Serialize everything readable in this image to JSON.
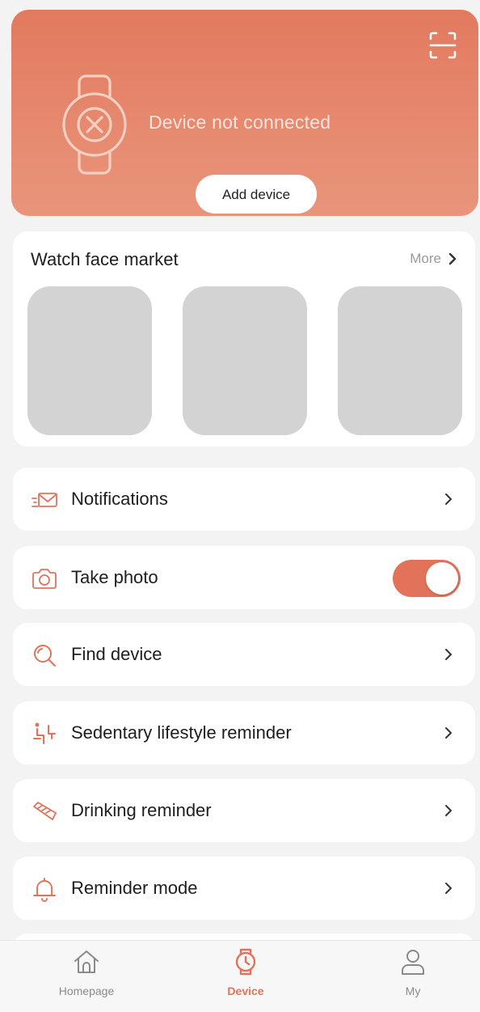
{
  "header": {
    "status": "Device not connected",
    "add_button": "Add device"
  },
  "market": {
    "title": "Watch face market",
    "more": "More"
  },
  "settings": [
    {
      "label": "Notifications",
      "icon": "envelope-icon",
      "control": "chevron"
    },
    {
      "label": "Take photo",
      "icon": "camera-icon",
      "control": "toggle",
      "toggle_on": true
    },
    {
      "label": "Find device",
      "icon": "magnifier-icon",
      "control": "chevron"
    },
    {
      "label": "Sedentary lifestyle reminder",
      "icon": "sedentary-icon",
      "control": "chevron"
    },
    {
      "label": "Drinking reminder",
      "icon": "cup-icon",
      "control": "chevron"
    },
    {
      "label": "Reminder mode",
      "icon": "bell-icon",
      "control": "chevron"
    }
  ],
  "tabs": [
    {
      "label": "Homepage",
      "icon": "home-icon",
      "active": false
    },
    {
      "label": "Device",
      "icon": "watch-icon",
      "active": true
    },
    {
      "label": "My",
      "icon": "person-icon",
      "active": false
    }
  ],
  "colors": {
    "accent": "#e2735a",
    "header_gradient_top": "#e27a5f",
    "header_gradient_bottom": "#e9957b",
    "placeholder": "#d3d3d3",
    "background": "#f3f3f4"
  }
}
